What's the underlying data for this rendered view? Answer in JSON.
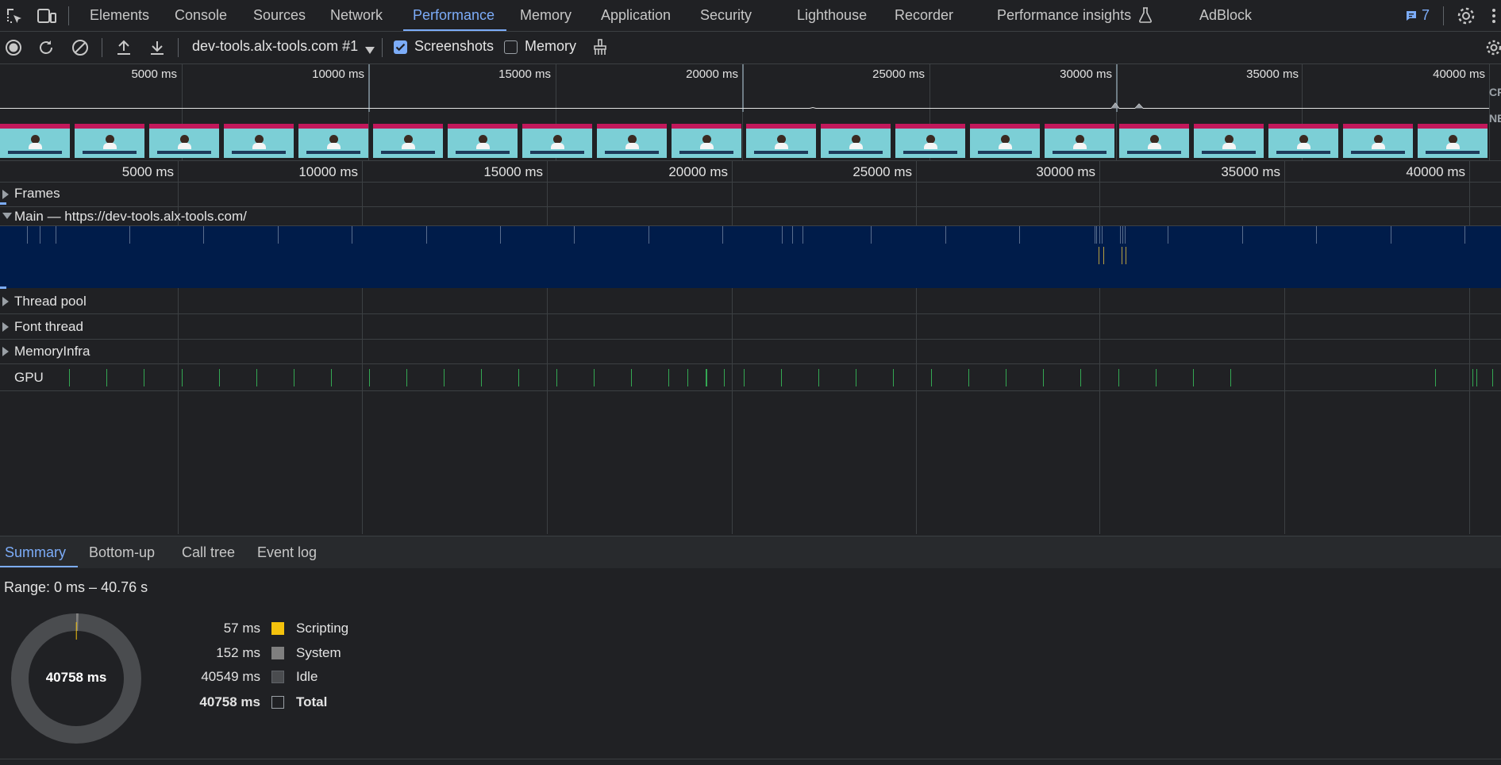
{
  "tabs": {
    "items": [
      "Elements",
      "Console",
      "Sources",
      "Network",
      "Performance",
      "Memory",
      "Application",
      "Security",
      "Lighthouse",
      "Recorder",
      "Performance insights",
      "AdBlock"
    ],
    "active": "Performance",
    "issues_count": "7"
  },
  "toolbar": {
    "target": "dev-tools.alx-tools.com #1",
    "screenshots_label": "Screenshots",
    "screenshots_checked": true,
    "memory_label": "Memory",
    "memory_checked": false
  },
  "overview": {
    "ticks": [
      "5000 ms",
      "10000 ms",
      "15000 ms",
      "20000 ms",
      "25000 ms",
      "30000 ms",
      "35000 ms",
      "40000 ms"
    ],
    "side_labels": [
      "CP",
      "NE"
    ]
  },
  "timeline": {
    "ticks": [
      "5000 ms",
      "10000 ms",
      "15000 ms",
      "20000 ms",
      "25000 ms",
      "30000 ms",
      "35000 ms",
      "40000 ms"
    ]
  },
  "tracks": {
    "frames": "Frames",
    "main": "Main — https://dev-tools.alx-tools.com/",
    "thread_pool": "Thread pool",
    "font_thread": "Font thread",
    "memory_infra": "MemoryInfra",
    "gpu": "GPU"
  },
  "bottom_tabs": {
    "items": [
      "Summary",
      "Bottom-up",
      "Call tree",
      "Event log"
    ],
    "active": "Summary"
  },
  "summary": {
    "range": "Range: 0 ms – 40.76 s",
    "total_center": "40758 ms",
    "rows": [
      {
        "value": "57 ms",
        "label": "Scripting",
        "color": "#f4c20d"
      },
      {
        "value": "152 ms",
        "label": "System",
        "color": "#7f7f7f"
      },
      {
        "value": "40549 ms",
        "label": "Idle",
        "color": "#4a4c4f"
      },
      {
        "value": "40758 ms",
        "label": "Total",
        "color": "transparent"
      }
    ]
  }
}
